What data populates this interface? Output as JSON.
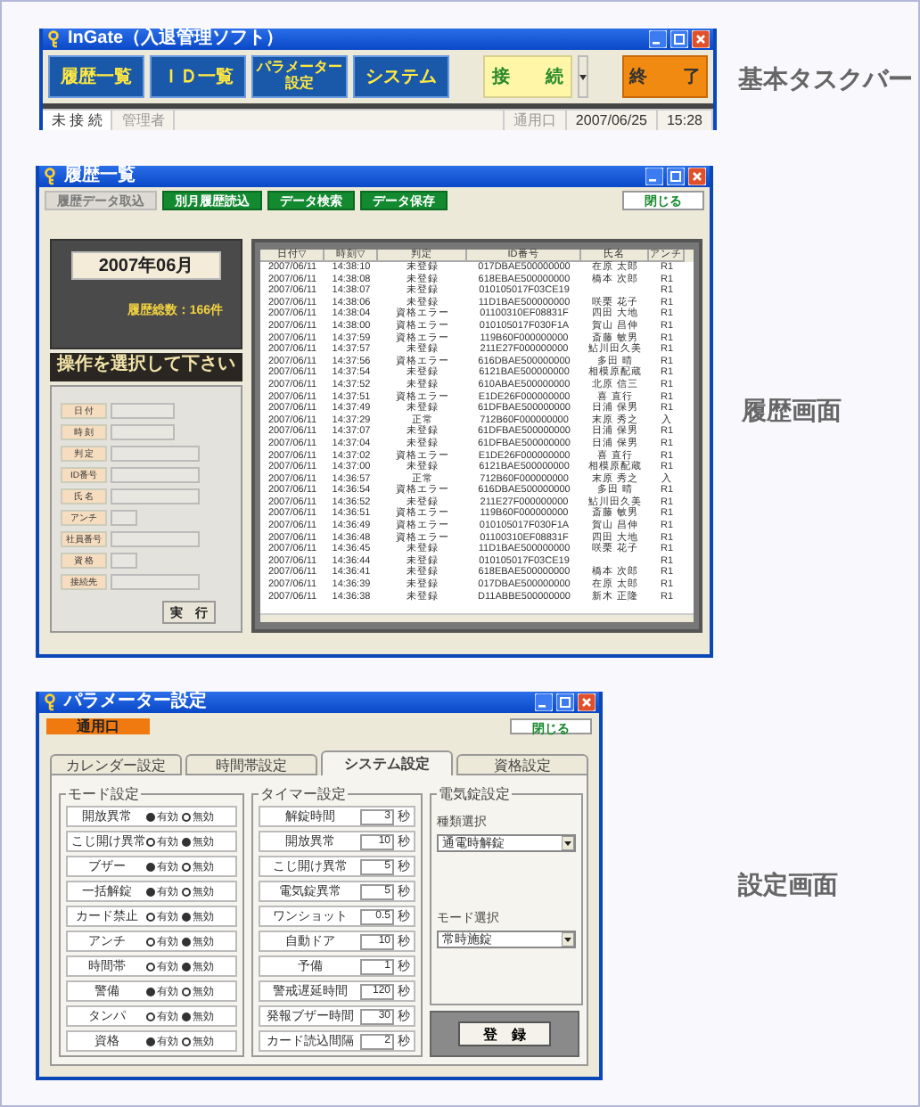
{
  "taskbar_window": {
    "title": "InGate（入退管理ソフト）",
    "nav_buttons": [
      {
        "label": "履歴一覧"
      },
      {
        "label": "ＩＤ一覧"
      },
      {
        "label": "パラメーター設定"
      },
      {
        "label": "システム"
      }
    ],
    "connect_button": "接　　続",
    "exit_button": "終　　了",
    "status_bar": [
      {
        "kind": "text",
        "text": "未 接 続",
        "disabled": false
      },
      {
        "kind": "text",
        "text": "管理者",
        "disabled": true
      },
      {
        "kind": "spacer"
      },
      {
        "kind": "text",
        "text": "通用口",
        "disabled": true
      },
      {
        "kind": "text",
        "text": "2007/06/25",
        "disabled": false
      },
      {
        "kind": "text",
        "text": "15:28",
        "disabled": false
      }
    ],
    "caption": "基本タスクバー"
  },
  "history_window": {
    "title": "履歴一覧",
    "toolbar": [
      {
        "label": "履歴データ取込",
        "disabled": true
      },
      {
        "label": "別月履歴読込",
        "disabled": false
      },
      {
        "label": "データ検索",
        "disabled": false
      },
      {
        "label": "データ保存",
        "disabled": false
      }
    ],
    "close_button": "閉じる",
    "month": "2007年06月",
    "total": "履歴総数：166件",
    "prompt": "操作を選択して下さい",
    "filters": [
      {
        "label": "日 付",
        "kind": "short"
      },
      {
        "label": "時 刻",
        "kind": "short"
      },
      {
        "label": "判 定",
        "kind": "long"
      },
      {
        "label": "ID番号",
        "kind": "long"
      },
      {
        "label": "氏 名",
        "kind": "long"
      },
      {
        "label": "アンチ",
        "kind": "tiny"
      },
      {
        "label": "社員番号",
        "kind": "long"
      },
      {
        "label": "資 格",
        "kind": "tiny"
      },
      {
        "label": "接続先",
        "kind": "long"
      }
    ],
    "run_button": "実　行",
    "table": {
      "columns": [
        "日付▽",
        "時刻▽",
        "判定",
        "ID番号",
        "氏名",
        "アンチ"
      ],
      "rows": [
        [
          "2007/06/11",
          "14:38:10",
          "未登録",
          "017DBAE500000000",
          "在原 太郎",
          "R1"
        ],
        [
          "2007/06/11",
          "14:38:08",
          "未登録",
          "618EBAE500000000",
          "橋本 次郎",
          "R1"
        ],
        [
          "2007/06/11",
          "14:38:07",
          "未登録",
          "010105017F03CE19",
          "",
          "R1"
        ],
        [
          "2007/06/11",
          "14:38:06",
          "未登録",
          "11D1BAE500000000",
          "咲栗 花子",
          "R1"
        ],
        [
          "2007/06/11",
          "14:38:04",
          "資格エラー",
          "01100310EF08831F",
          "四田 大地",
          "R1"
        ],
        [
          "2007/06/11",
          "14:38:00",
          "資格エラー",
          "010105017F030F1A",
          "賀山 昌伸",
          "R1"
        ],
        [
          "2007/06/11",
          "14:37:59",
          "資格エラー",
          "119B60F000000000",
          "斎藤 敏男",
          "R1"
        ],
        [
          "2007/06/11",
          "14:37:57",
          "未登録",
          "211E27F000000000",
          "鮎川田久美",
          "R1"
        ],
        [
          "2007/06/11",
          "14:37:56",
          "資格エラー",
          "616DBAE500000000",
          "多田 晴",
          "R1"
        ],
        [
          "2007/06/11",
          "14:37:54",
          "未登録",
          "6121BAE500000000",
          "相模原配蔵",
          "R1"
        ],
        [
          "2007/06/11",
          "14:37:52",
          "未登録",
          "610ABAE500000000",
          "北原 信三",
          "R1"
        ],
        [
          "2007/06/11",
          "14:37:51",
          "資格エラー",
          "E1DE26F000000000",
          "喜 直行",
          "R1"
        ],
        [
          "2007/06/11",
          "14:37:49",
          "未登録",
          "61DFBAE500000000",
          "日浦 保男",
          "R1"
        ],
        [
          "2007/06/11",
          "14:37:29",
          "正常",
          "712B60F000000000",
          "末原 秀之",
          "入"
        ],
        [
          "2007/06/11",
          "14:37:07",
          "未登録",
          "61DFBAE500000000",
          "日浦 保男",
          "R1"
        ],
        [
          "2007/06/11",
          "14:37:04",
          "未登録",
          "61DFBAE500000000",
          "日浦 保男",
          "R1"
        ],
        [
          "2007/06/11",
          "14:37:02",
          "資格エラー",
          "E1DE26F000000000",
          "喜 直行",
          "R1"
        ],
        [
          "2007/06/11",
          "14:37:00",
          "未登録",
          "6121BAE500000000",
          "相模原配蔵",
          "R1"
        ],
        [
          "2007/06/11",
          "14:36:57",
          "正常",
          "712B60F000000000",
          "末原 秀之",
          "入"
        ],
        [
          "2007/06/11",
          "14:36:54",
          "資格エラー",
          "616DBAE500000000",
          "多田 晴",
          "R1"
        ],
        [
          "2007/06/11",
          "14:36:52",
          "未登録",
          "211E27F000000000",
          "鮎川田久美",
          "R1"
        ],
        [
          "2007/06/11",
          "14:36:51",
          "資格エラー",
          "119B60F000000000",
          "斎藤 敏男",
          "R1"
        ],
        [
          "2007/06/11",
          "14:36:49",
          "資格エラー",
          "010105017F030F1A",
          "賀山 昌伸",
          "R1"
        ],
        [
          "2007/06/11",
          "14:36:48",
          "資格エラー",
          "01100310EF08831F",
          "四田 大地",
          "R1"
        ],
        [
          "2007/06/11",
          "14:36:45",
          "未登録",
          "11D1BAE500000000",
          "咲栗 花子",
          "R1"
        ],
        [
          "2007/06/11",
          "14:36:44",
          "未登録",
          "010105017F03CE19",
          "",
          "R1"
        ],
        [
          "2007/06/11",
          "14:36:41",
          "未登録",
          "618EBAE500000000",
          "橋本 次郎",
          "R1"
        ],
        [
          "2007/06/11",
          "14:36:39",
          "未登録",
          "017DBAE500000000",
          "在原 太郎",
          "R1"
        ],
        [
          "2007/06/11",
          "14:36:38",
          "未登録",
          "D11ABBE500000000",
          "新木 正隆",
          "R1"
        ]
      ]
    },
    "caption": "履歴画面"
  },
  "settings_window": {
    "title": "パラメーター設定",
    "gate_label": "通用口",
    "close_button": "閉じる",
    "tabs": [
      {
        "label": "カレンダー設定",
        "selected": false
      },
      {
        "label": "時間帯設定",
        "selected": false
      },
      {
        "label": "システム設定",
        "selected": true
      },
      {
        "label": "資格設定",
        "selected": false
      }
    ],
    "mode_group": {
      "title": "モード設定",
      "rows": [
        {
          "label": "開放異常",
          "options": [
            {
              "label": "有効",
              "selected": true
            },
            {
              "label": "無効",
              "selected": false
            }
          ]
        },
        {
          "label": "こじ開け異常",
          "options": [
            {
              "label": "有効",
              "selected": false
            },
            {
              "label": "無効",
              "selected": true
            }
          ]
        },
        {
          "label": "ブザー",
          "options": [
            {
              "label": "有効",
              "selected": true
            },
            {
              "label": "無効",
              "selected": false
            }
          ]
        },
        {
          "label": "一括解錠",
          "options": [
            {
              "label": "有効",
              "selected": true
            },
            {
              "label": "無効",
              "selected": false
            }
          ]
        },
        {
          "label": "カード禁止",
          "options": [
            {
              "label": "有効",
              "selected": false
            },
            {
              "label": "無効",
              "selected": true
            }
          ]
        },
        {
          "label": "アンチ",
          "options": [
            {
              "label": "有効",
              "selected": false
            },
            {
              "label": "無効",
              "selected": true
            }
          ]
        },
        {
          "label": "時間帯",
          "options": [
            {
              "label": "有効",
              "selected": false
            },
            {
              "label": "無効",
              "selected": true
            }
          ]
        },
        {
          "label": "警備",
          "options": [
            {
              "label": "有効",
              "selected": true
            },
            {
              "label": "無効",
              "selected": false
            }
          ]
        },
        {
          "label": "タンパ",
          "options": [
            {
              "label": "有効",
              "selected": false
            },
            {
              "label": "無効",
              "selected": true
            }
          ]
        },
        {
          "label": "資格",
          "options": [
            {
              "label": "有効",
              "selected": true
            },
            {
              "label": "無効",
              "selected": false
            }
          ]
        }
      ]
    },
    "timer_group": {
      "title": "タイマー設定",
      "rows": [
        {
          "label": "解錠時間",
          "value": "3",
          "unit": "秒"
        },
        {
          "label": "開放異常",
          "value": "10",
          "unit": "秒"
        },
        {
          "label": "こじ開け異常",
          "value": "5",
          "unit": "秒"
        },
        {
          "label": "電気錠異常",
          "value": "5",
          "unit": "秒"
        },
        {
          "label": "ワンショット",
          "value": "0.5",
          "unit": "秒"
        },
        {
          "label": "自動ドア",
          "value": "10",
          "unit": "秒"
        },
        {
          "label": "予備",
          "value": "1",
          "unit": "秒"
        },
        {
          "label": "警戒遅延時間",
          "value": "120",
          "unit": "秒"
        },
        {
          "label": "発報ブザー時間",
          "value": "30",
          "unit": "秒"
        },
        {
          "label": "カード読込間隔",
          "value": "2",
          "unit": "秒"
        }
      ]
    },
    "lock_group": {
      "title": "電気錠設定",
      "selects": [
        {
          "label": "種類選択",
          "value": "通電時解錠"
        },
        {
          "label": "モード選択",
          "value": "常時施錠"
        }
      ]
    },
    "register_button": "登　録",
    "caption": "設定画面"
  }
}
